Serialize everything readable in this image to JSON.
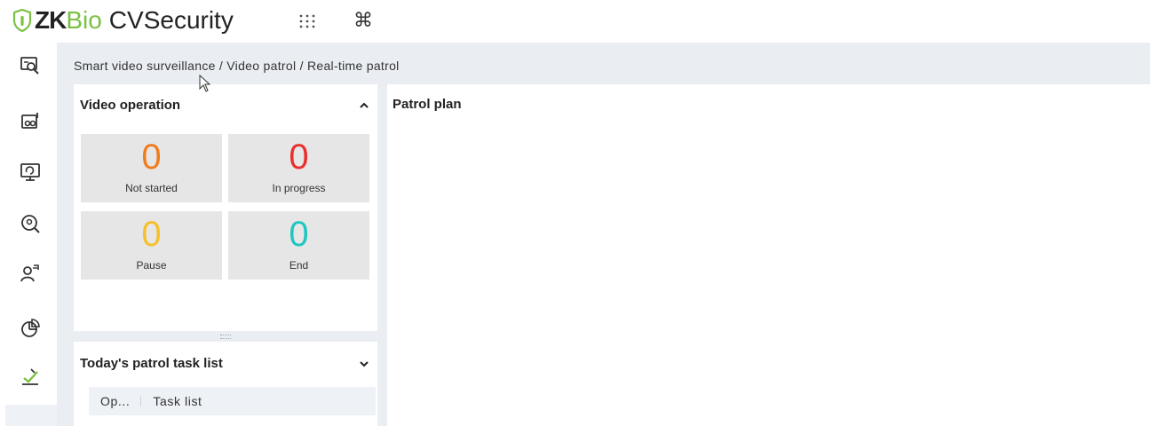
{
  "header": {
    "logo_zk": "ZK",
    "logo_bio": "Bio",
    "logo_product": "CVSecurity",
    "apps_icon": "grid-dots-icon",
    "command_icon": "command-icon",
    "command_glyph": "⌘"
  },
  "nav": {
    "items": [
      {
        "icon": "video-search-icon"
      },
      {
        "icon": "camera-device-icon"
      },
      {
        "icon": "monitor-refresh-icon"
      },
      {
        "icon": "face-search-icon"
      },
      {
        "icon": "person-tag-icon"
      },
      {
        "icon": "pie-chart-icon"
      },
      {
        "icon": "patrol-check-icon",
        "active": true
      }
    ],
    "accent_color": "#7ac143"
  },
  "breadcrumb": {
    "items": [
      "Smart video surveillance",
      "Video patrol",
      "Real-time patrol"
    ],
    "separator": " / "
  },
  "video_operation": {
    "title": "Video operation",
    "collapse_icon": "chevron-up-icon",
    "stats": [
      {
        "value": "0",
        "label": "Not started",
        "color": "#f07c1e"
      },
      {
        "value": "0",
        "label": "In progress",
        "color": "#e8312f"
      },
      {
        "value": "0",
        "label": "Pause",
        "color": "#f5c02c"
      },
      {
        "value": "0",
        "label": "End",
        "color": "#1fc7c0"
      }
    ]
  },
  "task_list": {
    "title": "Today's patrol task list",
    "expand_icon": "chevron-down-icon",
    "columns": [
      "Op...",
      "Task list"
    ]
  },
  "patrol_plan": {
    "title": "Patrol plan"
  }
}
